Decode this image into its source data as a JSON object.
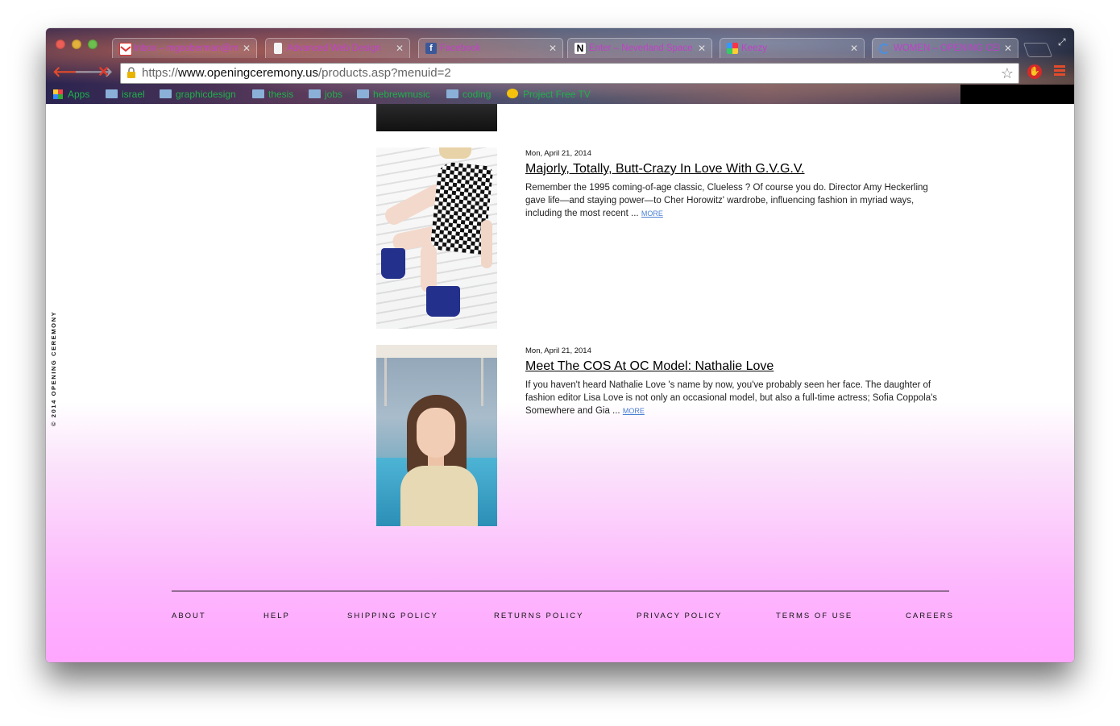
{
  "browser": {
    "tabs": [
      {
        "title": "Inbox – mgooberman@m",
        "icon": "gmail-icon",
        "active": false
      },
      {
        "title": "Advanced Web Design",
        "icon": "document-icon",
        "active": false
      },
      {
        "title": "Facebook",
        "icon": "facebook-icon",
        "active": false
      },
      {
        "title": "Enter – Neverland Space",
        "icon": "n-logo-icon",
        "active": false
      },
      {
        "title": "Keezy",
        "icon": "keezy-icon",
        "active": false
      },
      {
        "title": "WOMEN – OPENING CERE",
        "icon": "loading-spinner-icon",
        "active": true
      }
    ],
    "url_scheme": "https://",
    "url_domain": "www.openingceremony.us",
    "url_path": "/products.asp?menuid=2",
    "bookmarks": [
      {
        "label": "Apps",
        "icon": "apps-grid-icon"
      },
      {
        "label": "israel",
        "icon": "folder-icon"
      },
      {
        "label": "graphicdesign",
        "icon": "folder-icon"
      },
      {
        "label": "thesis",
        "icon": "folder-icon"
      },
      {
        "label": "jobs",
        "icon": "folder-icon"
      },
      {
        "label": "hebrewmusic",
        "icon": "folder-icon"
      },
      {
        "label": "coding",
        "icon": "folder-icon"
      },
      {
        "label": "Project Free TV",
        "icon": "project-free-tv-icon"
      }
    ]
  },
  "page": {
    "side_copyright": "© 2014 OPENING CEREMONY",
    "posts": [
      {
        "date": "Mon, April 21, 2014",
        "title": "Majorly, Totally, Butt-Crazy In Love With G.V.G.V.",
        "excerpt": "Remember the 1995 coming-of-age classic,  Clueless ? Of course you do. Director Amy Heckerling gave life—and staying power—to Cher Horowitz' wardrobe, influencing fashion in myriad ways, including the most recent ...",
        "more": "MORE"
      },
      {
        "date": "Mon, April 21, 2014",
        "title": "Meet The COS At OC Model: Nathalie Love",
        "excerpt": "If you haven't heard Nathalie Love 's name by now, you've probably seen her face. The daughter of fashion editor Lisa Love is not only an occasional model, but also a full-time actress; Sofia Coppola's Somewhere and Gia ...",
        "more": "MORE"
      }
    ],
    "footer_links": [
      "ABOUT",
      "HELP",
      "SHIPPING POLICY",
      "RETURNS POLICY",
      "PRIVACY POLICY",
      "TERMS OF USE",
      "CAREERS"
    ]
  }
}
